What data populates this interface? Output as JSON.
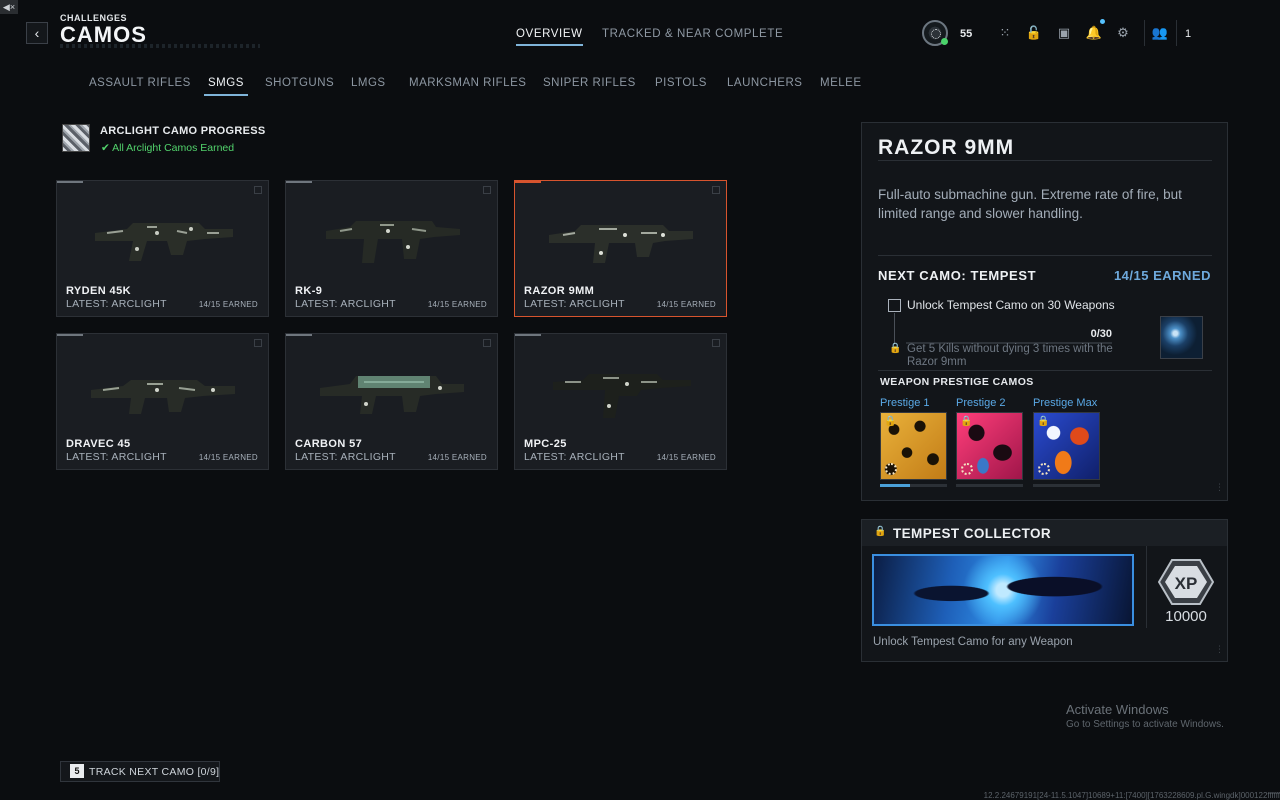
{
  "header": {
    "breadcrumb": "CHALLENGES",
    "title": "CAMOS",
    "tabs": [
      {
        "label": "OVERVIEW",
        "active": true
      },
      {
        "label": "TRACKED & NEAR COMPLETE",
        "active": false
      }
    ],
    "player_level": "55",
    "party_count": "1",
    "icons": [
      "back-icon",
      "rank-badge-icon",
      "grid-icon",
      "lock-icon",
      "camera-icon",
      "bell-icon",
      "gear-icon",
      "friends-icon"
    ]
  },
  "categories": [
    {
      "label": "ASSAULT RIFLES",
      "active": false
    },
    {
      "label": "SMGS",
      "active": true
    },
    {
      "label": "SHOTGUNS",
      "active": false
    },
    {
      "label": "LMGS",
      "active": false
    },
    {
      "label": "MARKSMAN RIFLES",
      "active": false
    },
    {
      "label": "SNIPER RIFLES",
      "active": false
    },
    {
      "label": "PISTOLS",
      "active": false
    },
    {
      "label": "LAUNCHERS",
      "active": false
    },
    {
      "label": "MELEE",
      "active": false
    }
  ],
  "arclight": {
    "title": "ARCLIGHT CAMO PROGRESS",
    "status": "✔ All Arclight Camos Earned"
  },
  "weapons": [
    {
      "name": "RYDEN 45K",
      "latest": "LATEST: ARCLIGHT",
      "earned": "14/15 EARNED",
      "selected": false
    },
    {
      "name": "RK-9",
      "latest": "LATEST: ARCLIGHT",
      "earned": "14/15 EARNED",
      "selected": false
    },
    {
      "name": "RAZOR 9MM",
      "latest": "LATEST: ARCLIGHT",
      "earned": "14/15 EARNED",
      "selected": true
    },
    {
      "name": "DRAVEC 45",
      "latest": "LATEST: ARCLIGHT",
      "earned": "14/15 EARNED",
      "selected": false
    },
    {
      "name": "CARBON 57",
      "latest": "LATEST: ARCLIGHT",
      "earned": "14/15 EARNED",
      "selected": false
    },
    {
      "name": "MPC-25",
      "latest": "LATEST: ARCLIGHT",
      "earned": "14/15 EARNED",
      "selected": false
    }
  ],
  "detail": {
    "title": "RAZOR 9MM",
    "description": "Full-auto submachine gun. Extreme rate of fire, but limited range and slower handling.",
    "next_camo": "NEXT CAMO: TEMPEST",
    "next_earned": "14/15 EARNED",
    "challenge_1": "Unlock Tempest Camo on 30 Weapons",
    "challenge_progress": "0/30",
    "challenge_2": "Get 5 Kills without dying 3 times with the Razor 9mm",
    "prestige_heading": "WEAPON PRESTIGE CAMOS",
    "prestige": [
      {
        "label": "Prestige 1",
        "progress": 0.45
      },
      {
        "label": "Prestige 2",
        "progress": 0
      },
      {
        "label": "Prestige Max",
        "progress": 0
      }
    ]
  },
  "collector": {
    "title": "TEMPEST COLLECTOR",
    "xp_label": "XP",
    "xp_amount": "10000",
    "description": "Unlock Tempest Camo for any Weapon"
  },
  "watermark": {
    "line1": "Activate Windows",
    "line2": "Go to Settings to activate Windows."
  },
  "footer": {
    "track_key": "5",
    "track_label": "TRACK NEXT CAMO [0/9]",
    "build_string": "12.2.24679191[24-11.5.1047]10689+11:[7400][1763228609.pl.G.wingdk]000122ffffff"
  },
  "colors": {
    "accent_blue": "#6ea9dc",
    "selected_orange": "#d7542e",
    "success_green": "#52d36c"
  }
}
